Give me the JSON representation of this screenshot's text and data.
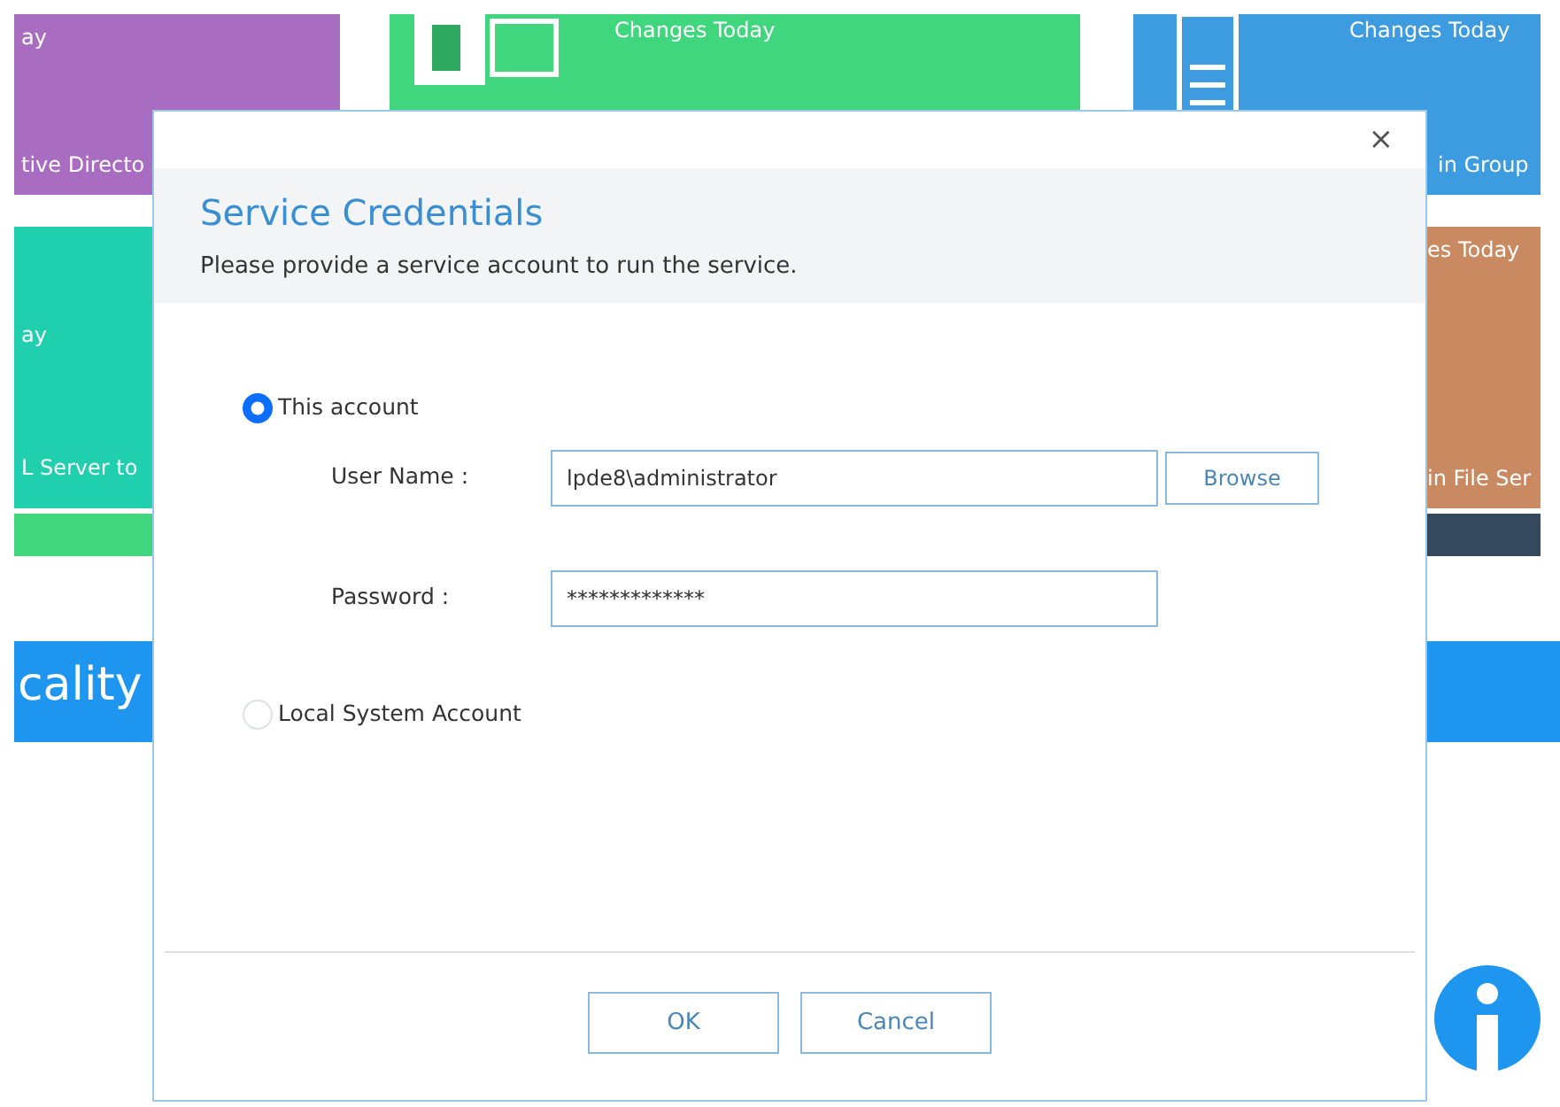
{
  "background": {
    "tiles": [
      {
        "kind": "tile",
        "color": "#a86cc1",
        "lines": [
          "ay",
          "tive Directo"
        ]
      },
      {
        "kind": "exchange",
        "color": "#3fd67e",
        "lines": [
          "Changes Today"
        ]
      },
      {
        "kind": "scroll",
        "color": "#3d9be0",
        "lines": [
          "Changes Today",
          "in Group"
        ]
      },
      {
        "kind": "tile",
        "color": "#1fcfae",
        "lines": [
          "ay",
          "L Server to"
        ]
      },
      {
        "kind": "right",
        "color": "#c98a62",
        "lines": [
          "es Today",
          "in File Ser"
        ]
      },
      {
        "kind": "bar",
        "color": "#3fd67e"
      },
      {
        "kind": "rightbar",
        "color": "#34495e"
      }
    ],
    "band": {
      "text": "cality"
    }
  },
  "dialog": {
    "close": "×",
    "title": "Service Credentials",
    "subtitle": "Please provide a service account to run the service.",
    "options": [
      {
        "label": "This account",
        "selected": true,
        "fields": [
          {
            "label": "User Name :",
            "value": "lpde8\\administrator",
            "button": "Browse"
          },
          {
            "label": "Password  :",
            "value": "*************"
          }
        ]
      },
      {
        "label": "Local System Account",
        "selected": false
      }
    ],
    "buttons": [
      "OK",
      "Cancel"
    ]
  }
}
